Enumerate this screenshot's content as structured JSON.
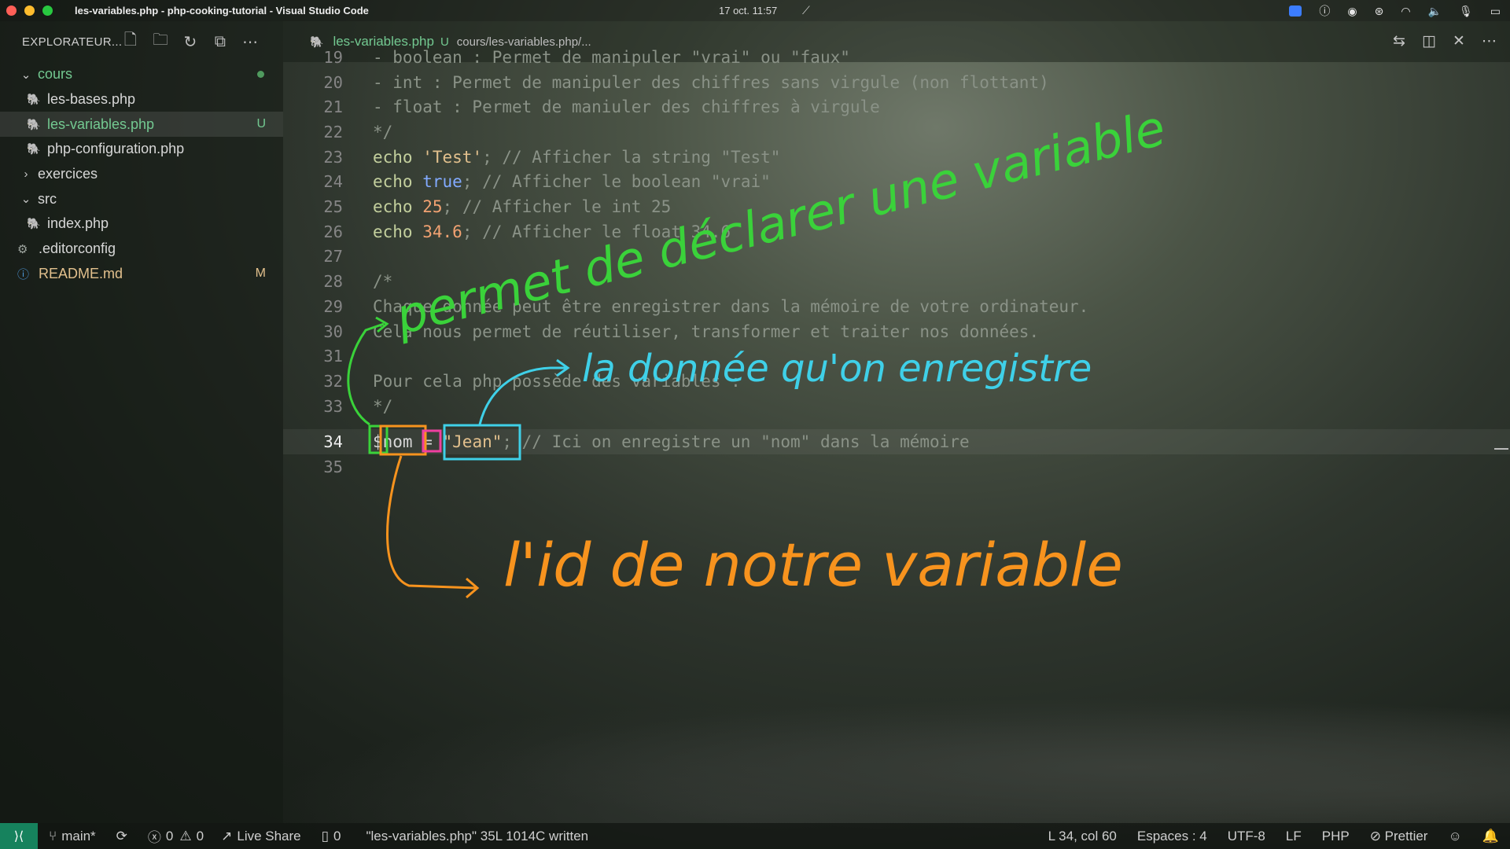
{
  "window": {
    "title": "les-variables.php - php-cooking-tutorial - Visual Studio Code",
    "clock": "17 oct.  11:57"
  },
  "sidebar": {
    "header": "EXPLORATEUR...",
    "items": [
      {
        "label": "cours"
      },
      {
        "label": "les-bases.php"
      },
      {
        "label": "les-variables.php",
        "badge": "U"
      },
      {
        "label": "php-configuration.php"
      },
      {
        "label": "exercices"
      },
      {
        "label": "src"
      },
      {
        "label": "index.php"
      },
      {
        "label": ".editorconfig"
      },
      {
        "label": "README.md",
        "badge": "M"
      }
    ]
  },
  "tab": {
    "label": "les-variables.php",
    "status": "U",
    "path": "cours/les-variables.php/..."
  },
  "editor": {
    "lines": [
      {
        "n": "19",
        "text": "- boolean : Permet de manipuler \"vrai\" ou \"faux\""
      },
      {
        "n": "20",
        "text": "- int : Permet de manipuler des chiffres sans virgule (non flottant)"
      },
      {
        "n": "21",
        "text": "- float : Permet de maniuler des chiffres à virgule"
      },
      {
        "n": "22",
        "text": "*/"
      },
      {
        "n": "23",
        "kw": "echo",
        "val": "'Test'",
        "rest": "; // Afficher la string \"Test\""
      },
      {
        "n": "24",
        "kw": "echo",
        "val": "true",
        "rest": "; // Afficher le boolean \"vrai\""
      },
      {
        "n": "25",
        "kw": "echo",
        "val": "25",
        "rest": "; // Afficher le int 25"
      },
      {
        "n": "26",
        "kw": "echo",
        "val": "34.6",
        "rest": "; // Afficher le float 34.6"
      },
      {
        "n": "27",
        "text": ""
      },
      {
        "n": "28",
        "text": "/*"
      },
      {
        "n": "29",
        "text": "Chaque donnée peut être enregistrer dans la mémoire de votre ordinateur."
      },
      {
        "n": "30",
        "text": "Cela nous permet de réutiliser, transformer et traiter nos données."
      },
      {
        "n": "31",
        "text": ""
      },
      {
        "n": "32",
        "text": "Pour cela php possède des variables :"
      },
      {
        "n": "33",
        "text": "*/"
      },
      {
        "n": "34",
        "var": "$nom",
        "op": " = ",
        "val": "\"Jean\"",
        "rest": "; // Ici on enregistre un \"nom\" dans la mémoire"
      },
      {
        "n": "35",
        "text": ""
      }
    ]
  },
  "annotations": {
    "green": "permet de déclarer une variable",
    "blue": "la donnée qu'on enregistre",
    "orange": "l'id de notre variable"
  },
  "statusbar": {
    "branch": "main*",
    "errors": "0",
    "warnings": "0",
    "liveshare": "Live Share",
    "files": "0",
    "message": "\"les-variables.php\" 35L 1014C written",
    "position": "L 34, col 60",
    "spaces": "Espaces : 4",
    "encoding": "UTF-8",
    "eol": "LF",
    "language": "PHP",
    "formatter": "Prettier"
  }
}
